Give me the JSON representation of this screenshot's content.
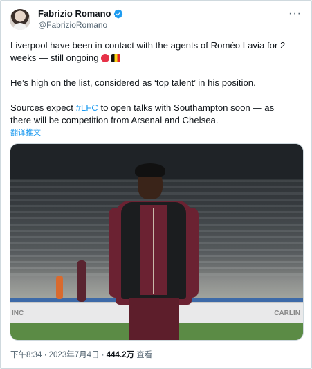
{
  "author": {
    "name": "Fabrizio Romano",
    "handle": "@FabrizioRomano"
  },
  "tweet": {
    "line1": "Liverpool have been in contact with the agents of Roméo Lavia for 2 weeks — still ongoing",
    "line2": "He’s high on the list, considered as ‘top talent’ in his position.",
    "line3_pre": "Sources expect ",
    "hashtag": "#LFC",
    "line3_post": " to open talks with Southampton soon — as there will be competition from Arsenal and Chelsea.",
    "translate_label": "翻译推文"
  },
  "photo": {
    "ad_left": "INC",
    "ad_right": "CARLIN"
  },
  "meta": {
    "time": "下午8:34",
    "date": "2023年7月4日",
    "separator": "·",
    "views_count": "444.2万",
    "views_label": "查看"
  },
  "icons": {
    "verified": "verified-badge-icon",
    "more": "more-options-icon",
    "emoji_red": "red-circle-emoji-icon",
    "emoji_flag": "belgium-flag-emoji-icon"
  },
  "colors": {
    "accent": "#1d9bf0",
    "text": "#0f1419",
    "secondary": "#536471"
  }
}
